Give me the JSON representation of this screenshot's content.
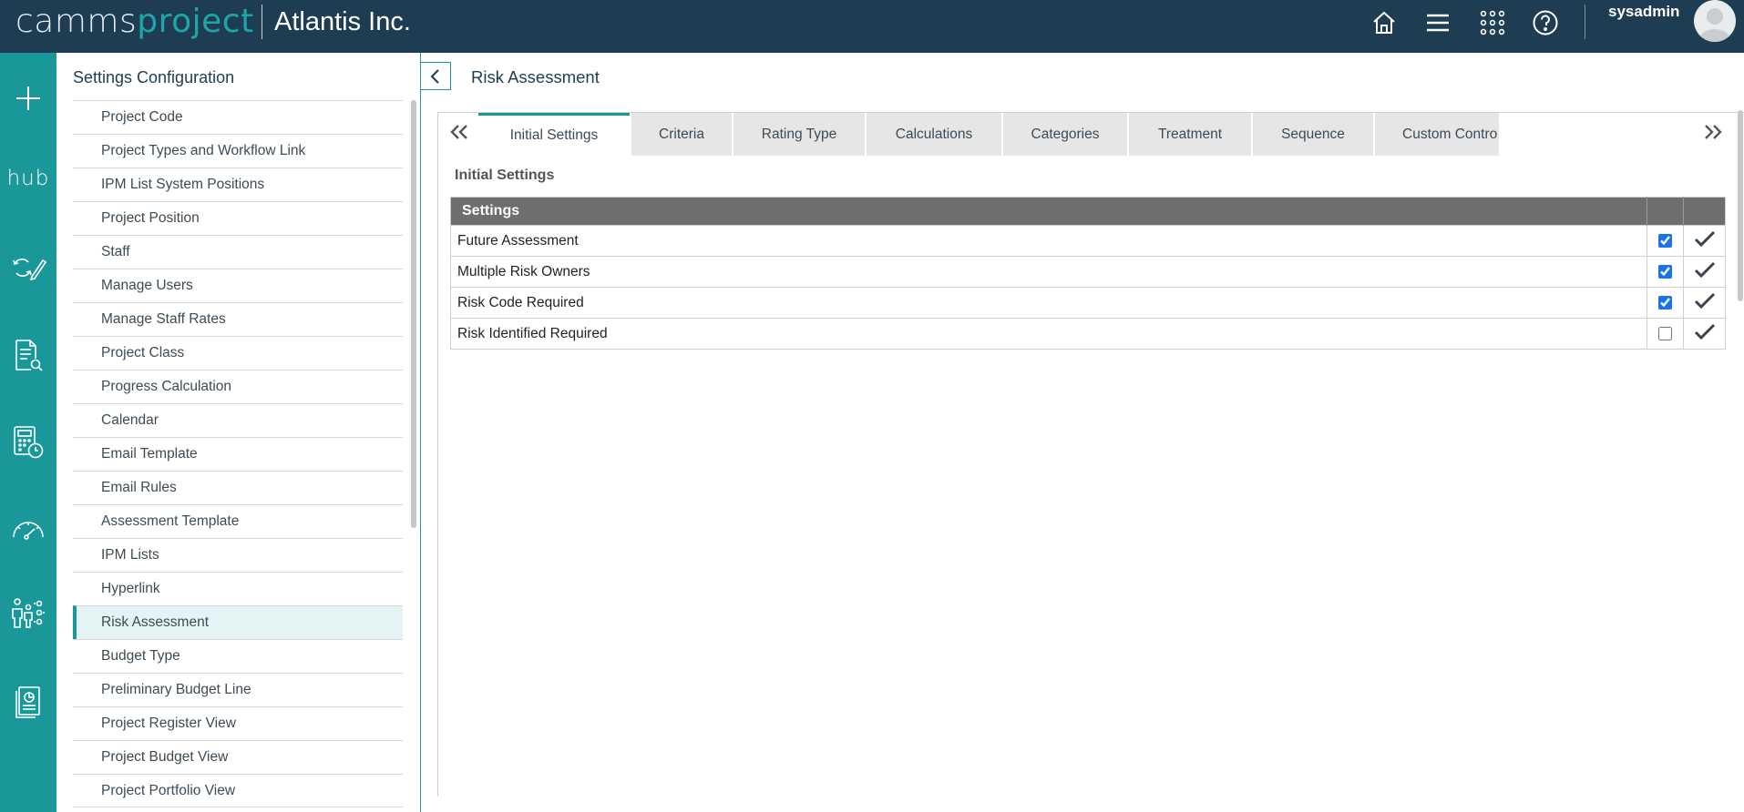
{
  "header": {
    "logo_part1": "camms",
    "logo_part2": "project",
    "org_name": "Atlantis Inc.",
    "username": "sysadmin",
    "icons": [
      "home-icon",
      "menu-icon",
      "apps-grid-icon",
      "help-icon"
    ]
  },
  "rail": {
    "hub_label": "hub",
    "icons": [
      "plus-icon",
      "hub-icon",
      "refresh-edit-icon",
      "document-search-icon",
      "calculator-clock-icon",
      "gauge-icon",
      "people-settings-icon",
      "report-icon"
    ]
  },
  "settings_panel": {
    "title": "Settings Configuration",
    "items": [
      {
        "label": "Project Code"
      },
      {
        "label": "Project Types and Workflow Link"
      },
      {
        "label": "IPM List System Positions"
      },
      {
        "label": "Project Position"
      },
      {
        "label": "Staff"
      },
      {
        "label": "Manage Users"
      },
      {
        "label": "Manage Staff Rates"
      },
      {
        "label": "Project Class"
      },
      {
        "label": "Progress Calculation"
      },
      {
        "label": "Calendar"
      },
      {
        "label": "Email Template"
      },
      {
        "label": "Email Rules"
      },
      {
        "label": "Assessment Template"
      },
      {
        "label": "IPM Lists"
      },
      {
        "label": "Hyperlink"
      },
      {
        "label": "Risk Assessment"
      },
      {
        "label": "Budget Type"
      },
      {
        "label": "Preliminary Budget Line"
      },
      {
        "label": "Project Register View"
      },
      {
        "label": "Project Budget View"
      },
      {
        "label": "Project Portfolio View"
      }
    ],
    "active_item": "Risk Assessment"
  },
  "main": {
    "page_title": "Risk Assessment",
    "tabs": [
      {
        "label": "Initial Settings"
      },
      {
        "label": "Criteria"
      },
      {
        "label": "Rating Type"
      },
      {
        "label": "Calculations"
      },
      {
        "label": "Categories"
      },
      {
        "label": "Treatment"
      },
      {
        "label": "Sequence"
      },
      {
        "label": "Custom Contro"
      }
    ],
    "active_tab": "Initial Settings",
    "section_title": "Initial Settings",
    "table": {
      "header": "Settings",
      "rows": [
        {
          "label": "Future Assessment",
          "checked": true
        },
        {
          "label": "Multiple Risk Owners",
          "checked": true
        },
        {
          "label": "Risk Code Required",
          "checked": true
        },
        {
          "label": "Risk Identified Required",
          "checked": false
        }
      ]
    }
  },
  "colors": {
    "topbar": "#1e3d52",
    "rail": "#1a9799",
    "accent": "#1a9799",
    "table_header": "#6e6e6e"
  }
}
